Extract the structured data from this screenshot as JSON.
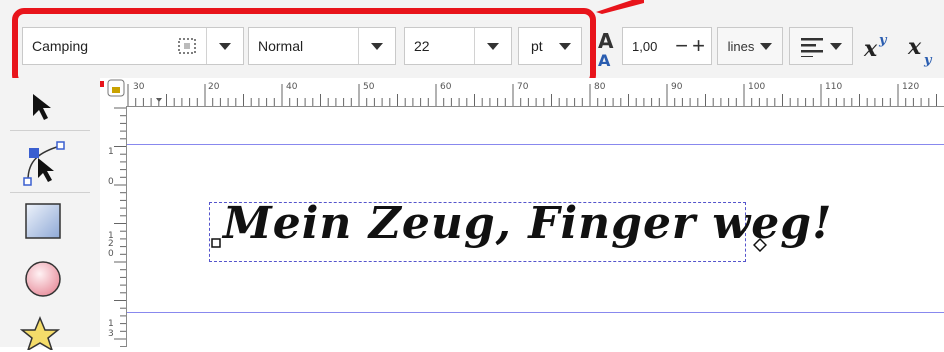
{
  "toolbar": {
    "font_family": "Camping",
    "font_style": "Normal",
    "font_size": "22",
    "unit": "pt",
    "line_spacing": "1,00",
    "line_unit": "lines"
  },
  "ruler": {
    "h_ticks": [
      "30",
      "20",
      "40",
      "50",
      "60",
      "70",
      "80",
      "90",
      "100",
      "110",
      "120"
    ],
    "v_ticks": [
      "1",
      "0",
      "1",
      "2",
      "0",
      "1",
      "3"
    ]
  },
  "canvas": {
    "text": "Mein Zeug, Finger weg!"
  },
  "colors": {
    "highlight": "#e8141b",
    "guide": "#8888ee"
  }
}
